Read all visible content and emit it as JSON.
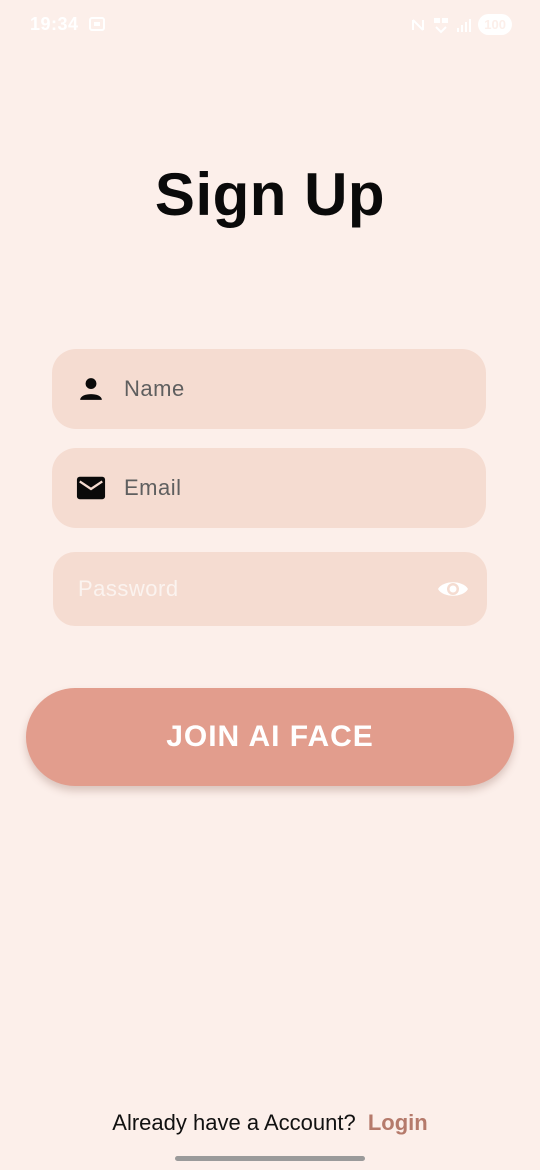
{
  "status_bar": {
    "time": "19:34",
    "battery": "100"
  },
  "screen": {
    "title": "Sign Up"
  },
  "form": {
    "name_placeholder": "Name",
    "email_placeholder": "Email",
    "password_placeholder": "Password"
  },
  "icons": {
    "name": "person-icon",
    "email": "mail-icon",
    "password_toggle": "eye-icon"
  },
  "actions": {
    "join_label": "JOIN AI FACE"
  },
  "footer": {
    "prompt": "Already have a Account?",
    "login_label": "Login"
  },
  "colors": {
    "background": "#fcefea",
    "field": "#f5dcd1",
    "button": "#e29d8d",
    "link": "#b57a6b"
  }
}
